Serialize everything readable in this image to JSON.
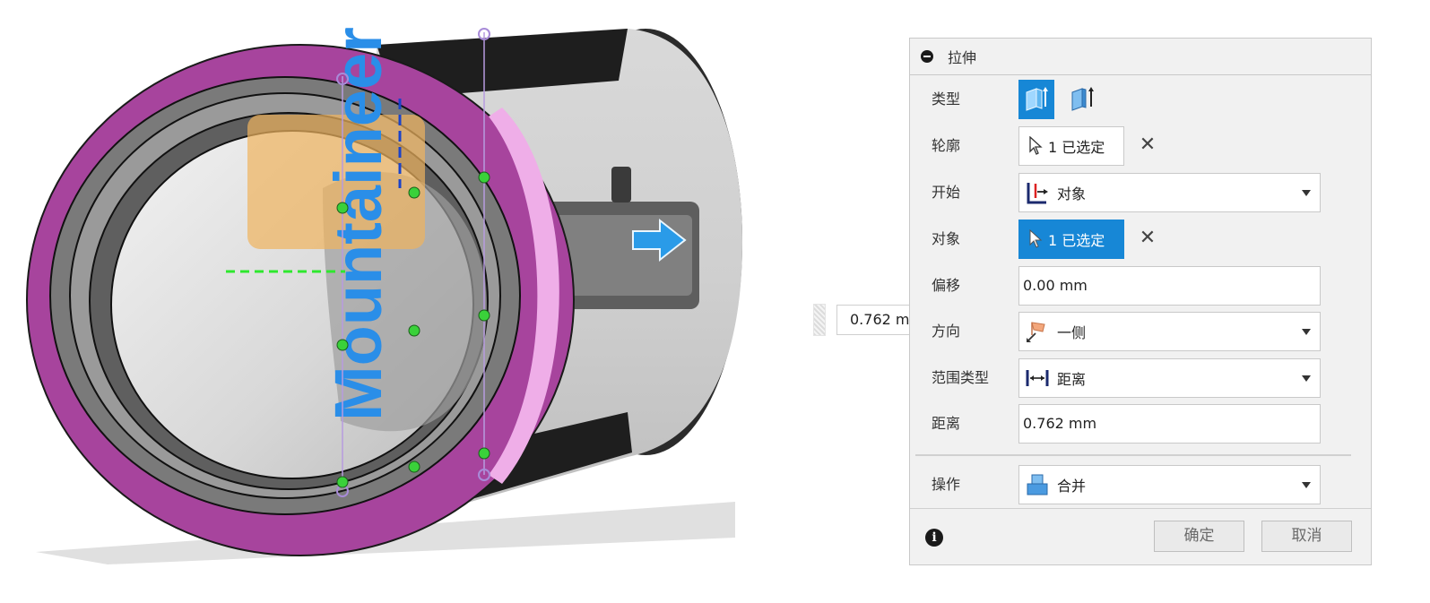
{
  "viewport": {
    "model_text": "Mountaineer",
    "floating_input_value": "0.762 m"
  },
  "panel": {
    "title": "拉伸",
    "rows": {
      "type": {
        "label": "类型"
      },
      "profile": {
        "label": "轮廓",
        "value": "1 已选定"
      },
      "start": {
        "label": "开始",
        "value": "对象"
      },
      "object": {
        "label": "对象",
        "value": "1 已选定"
      },
      "offset": {
        "label": "偏移",
        "value": "0.00 mm"
      },
      "direction": {
        "label": "方向",
        "value": "一侧"
      },
      "extent_type": {
        "label": "范围类型",
        "value": "距离"
      },
      "distance": {
        "label": "距离",
        "value": "0.762 mm"
      },
      "operation": {
        "label": "操作",
        "value": "合并"
      }
    },
    "footer": {
      "ok_label": "确定",
      "cancel_label": "取消"
    }
  },
  "icons": {
    "collapse": "collapse-icon",
    "extrude_type": "solid-extrude-icon",
    "thin_extrude": "thin-extrude-icon",
    "cursor": "cursor-icon",
    "clear": "close-icon",
    "start_object": "start-from-object-icon",
    "direction": "one-side-icon",
    "extent": "distance-icon",
    "operation": "join-icon",
    "info": "info-icon"
  },
  "colors": {
    "accent": "#1787d6",
    "face_magenta": "#a7449d",
    "preview_blue": "#2a8ee8"
  }
}
